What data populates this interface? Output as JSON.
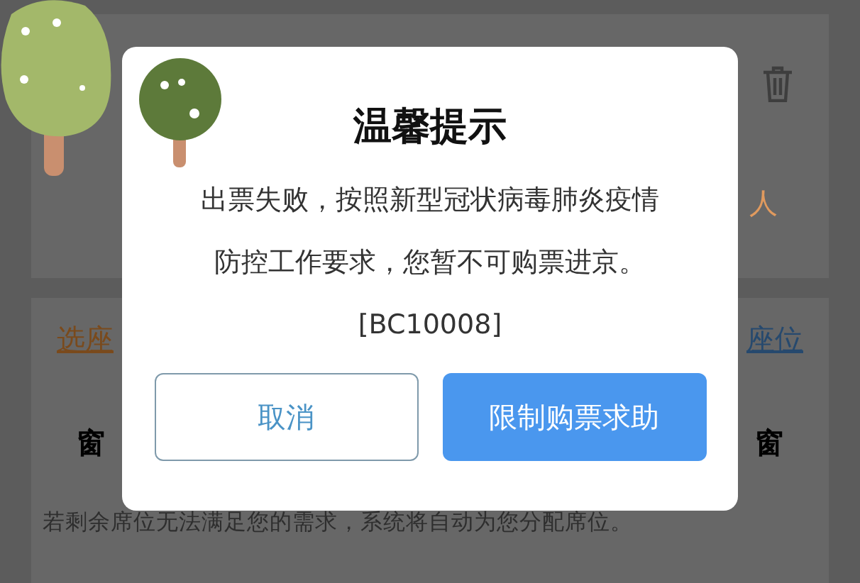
{
  "background": {
    "right_partial": "人",
    "seat_link": "选座",
    "seat_link_right": "座位",
    "window_labels": [
      "窗",
      "窗"
    ],
    "note": "若剩余席位无法满足您的需求，系统将自动为您分配席位。"
  },
  "dialog": {
    "title": "温馨提示",
    "message_lines": [
      "出票失败，按照新型冠状病毒肺炎疫情",
      "防控工作要求，您暂不可购票进京。"
    ],
    "code": "[BC10008]",
    "buttons": [
      {
        "label": "取消",
        "kind": "secondary"
      },
      {
        "label": "限制购票求助",
        "kind": "primary"
      }
    ]
  }
}
